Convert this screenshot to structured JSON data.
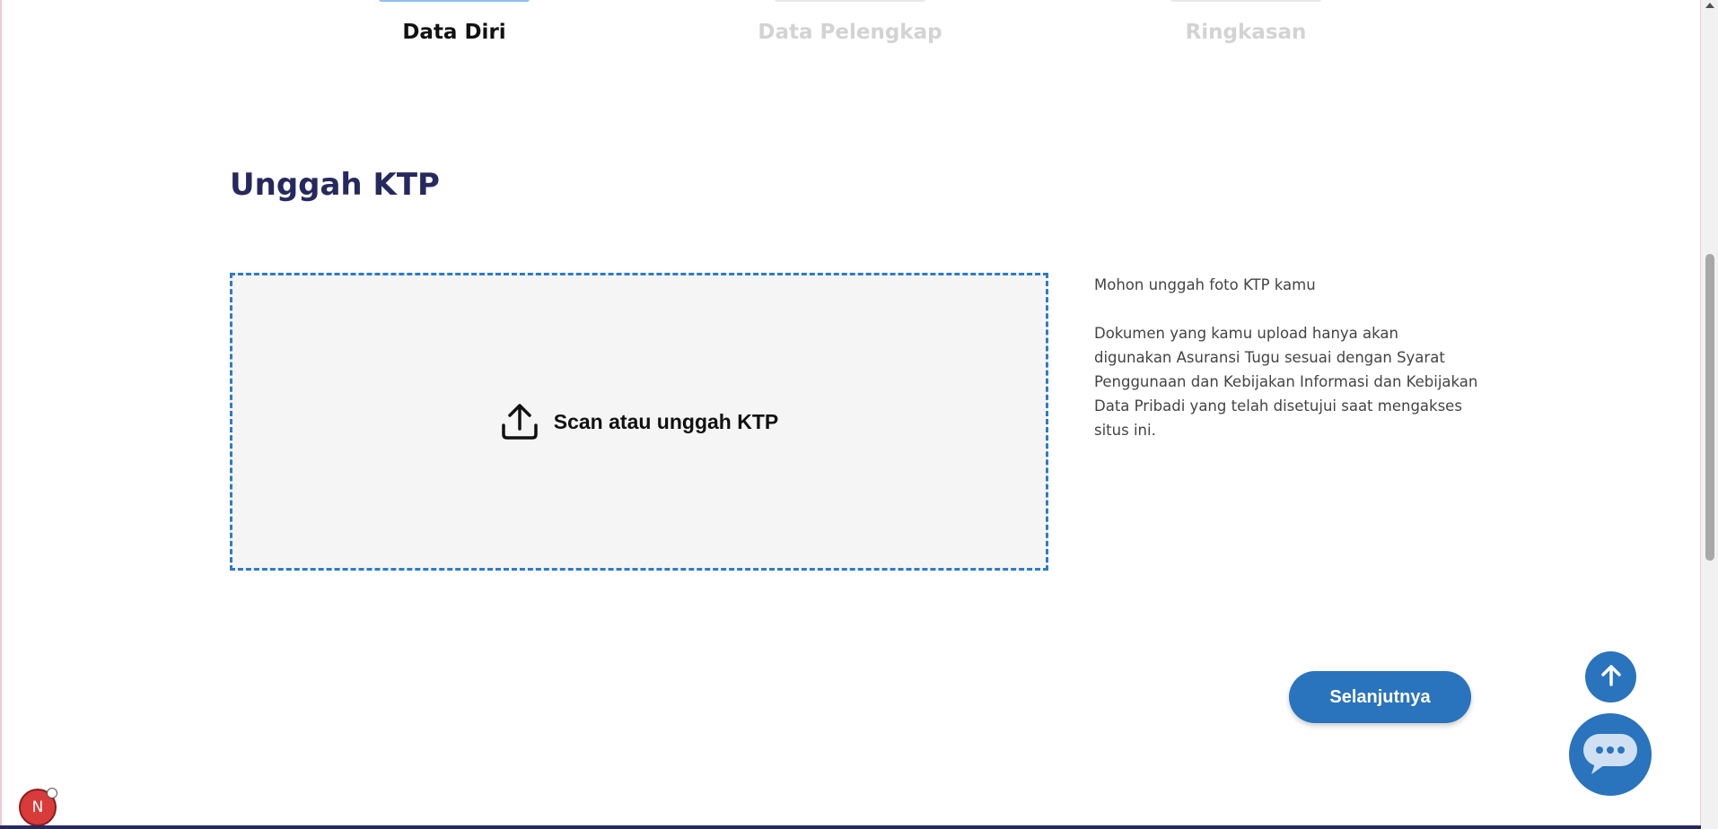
{
  "stepper": {
    "steps": [
      {
        "label": "Data Diri",
        "state": "active"
      },
      {
        "label": "Data Pelengkap",
        "state": "inactive"
      },
      {
        "label": "Ringkasan",
        "state": "inactive"
      }
    ]
  },
  "main": {
    "title": "Unggah KTP",
    "upload": {
      "label": "Scan atau unggah KTP",
      "icon": "upload-icon"
    },
    "info": {
      "line1": "Mohon unggah foto KTP kamu",
      "line2": "Dokumen yang kamu upload hanya akan digunakan Asuransi Tugu sesuai dengan Syarat Penggunaan dan Kebijakan Informasi dan Kebijakan Data Pribadi yang telah disetujui saat mengakses situs ini."
    },
    "next_label": "Selanjutnya"
  },
  "floating": {
    "scroll_top_icon": "arrow-up-icon",
    "chat_icon": "chat-bubble-icon",
    "dev_badge_label": "N"
  },
  "colors": {
    "primary": "#2a73bd",
    "title": "#25295e",
    "upload_border": "#2d7cc6",
    "upload_bg": "#f5f5f5",
    "step_active_bar": "#8cc0ef",
    "step_inactive_text": "#d3d3d3"
  }
}
